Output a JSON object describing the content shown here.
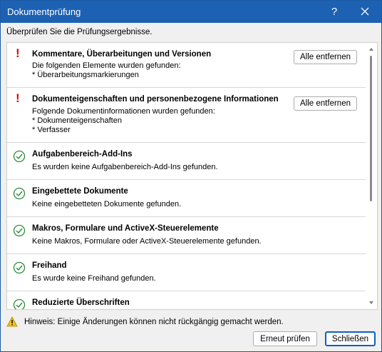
{
  "window": {
    "title": "Dokumentprüfung",
    "help_label": "?",
    "intro": "Überprüfen Sie die Prüfungsergebnisse."
  },
  "results": [
    {
      "status": "warning",
      "title": "Kommentare, Überarbeitungen und Versionen",
      "lines": [
        "Die folgenden Elemente wurden gefunden:",
        "* Überarbeitungsmarkierungen"
      ],
      "button": "Alle entfernen"
    },
    {
      "status": "warning",
      "title": "Dokumenteigenschaften und personenbezogene Informationen",
      "lines": [
        "Folgende Dokumentinformationen wurden gefunden:",
        "* Dokumenteigenschaften",
        "* Verfasser"
      ],
      "button": "Alle entfernen"
    },
    {
      "status": "ok",
      "title": "Aufgabenbereich-Add-Ins",
      "lines": [
        "Es wurden keine Aufgabenbereich-Add-Ins gefunden."
      ]
    },
    {
      "status": "ok",
      "title": "Eingebettete Dokumente",
      "lines": [
        "Keine eingebetteten Dokumente gefunden."
      ]
    },
    {
      "status": "ok",
      "title": "Makros, Formulare und ActiveX-Steuerelemente",
      "lines": [
        "Keine Makros, Formulare oder ActiveX-Steuerelemente gefunden."
      ]
    },
    {
      "status": "ok",
      "title": "Freihand",
      "lines": [
        "Es wurde keine Freihand gefunden."
      ]
    },
    {
      "status": "ok",
      "title": "Reduzierte Überschriften",
      "lines": []
    }
  ],
  "footer": {
    "hint": "Hinweis: Einige Änderungen können nicht rückgängig gemacht werden.",
    "recheck_label": "Erneut prüfen",
    "close_label": "Schließen"
  },
  "colors": {
    "titlebar": "#1d61b3",
    "warning": "#d40b0b",
    "ok": "#2e8b3a",
    "default_button_border": "#0b5fc4"
  },
  "icons": {
    "warning": "exclamation-icon",
    "ok": "check-circle-icon",
    "hint": "warning-triangle-icon"
  }
}
